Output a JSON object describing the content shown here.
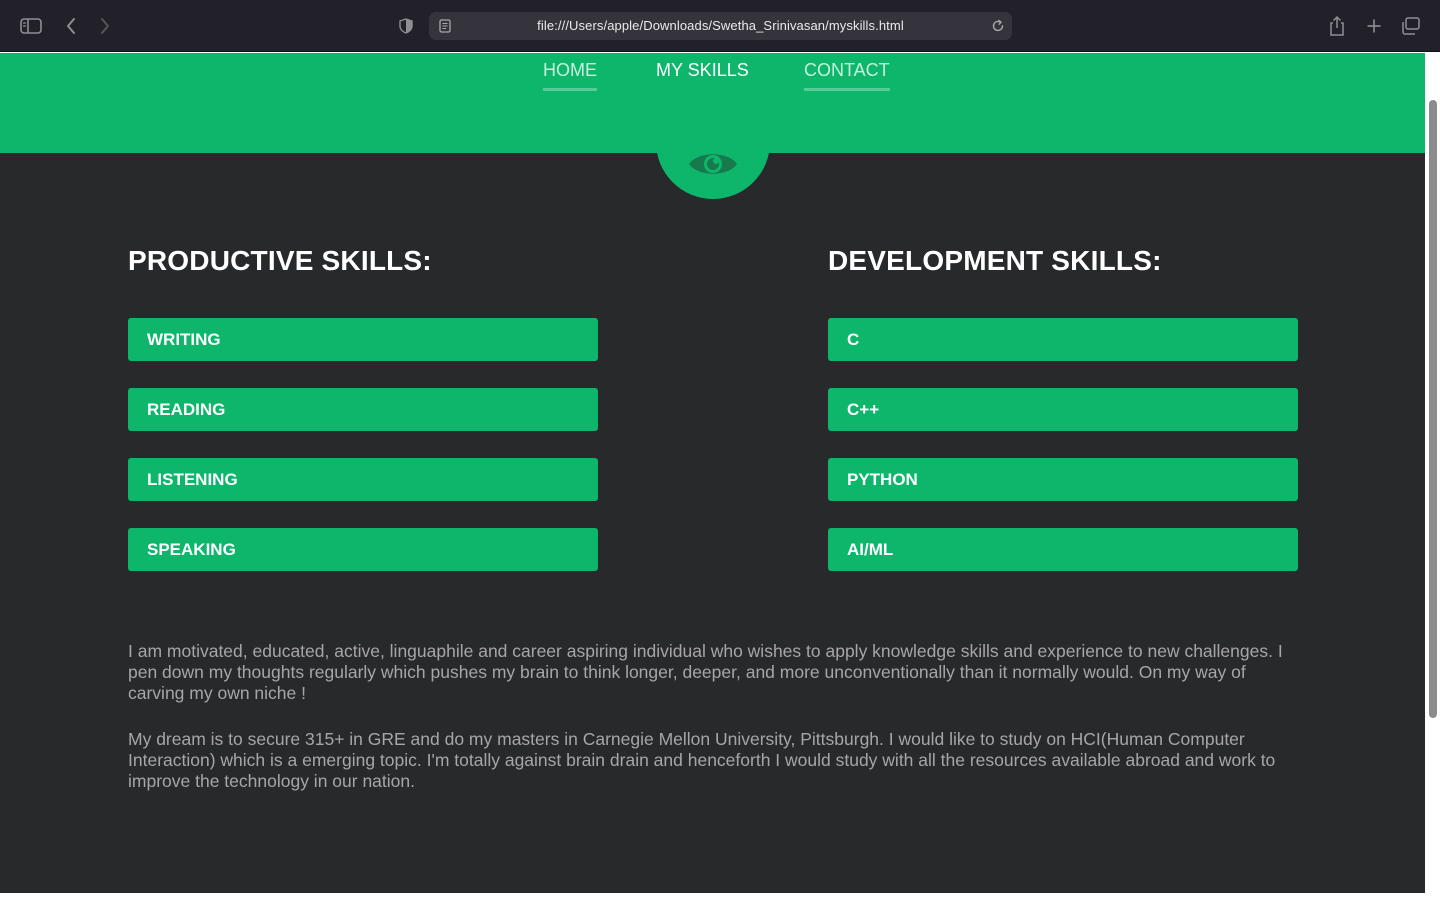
{
  "browser": {
    "url": "file:///Users/apple/Downloads/Swetha_Srinivasan/myskills.html",
    "icons": {
      "sidebar": "sidebar-icon",
      "back": "chevron-left-icon",
      "forward": "chevron-right-icon",
      "privacy": "shield-icon",
      "page": "page-icon",
      "reload": "reload-icon",
      "share": "share-icon",
      "new_tab": "plus-icon",
      "tabs": "tab-overview-icon"
    }
  },
  "nav": {
    "items": [
      {
        "label": "HOME"
      },
      {
        "label": "MY SKILLS",
        "active": true
      },
      {
        "label": "CONTACT"
      }
    ]
  },
  "badge_icon": "eye-icon",
  "colors": {
    "accent": "#0db66b",
    "background": "#28292b",
    "text_muted": "#a6a6a8"
  },
  "productive": {
    "title": "PRODUCTIVE SKILLS:",
    "skills": [
      "WRITING",
      "READING",
      "LISTENING",
      "SPEAKING"
    ]
  },
  "development": {
    "title": "DEVELOPMENT SKILLS:",
    "skills": [
      "C",
      "C++",
      "PYTHON",
      "AI/ML"
    ]
  },
  "about": {
    "paragraph1": "I am motivated, educated, active, linguaphile and career aspiring individual who wishes to apply knowledge skills and experience to new challenges. I pen down my thoughts regularly which pushes my brain to think longer, deeper, and more unconventionally than it normally would. On my way of carving my own niche !",
    "paragraph2": "My dream is to secure 315+ in GRE and do my masters in Carnegie Mellon University, Pittsburgh. I would like to study on HCI(Human Computer Interaction) which is a emerging topic. I'm totally against brain drain and henceforth I would study with all the resources available abroad and work to improve the technology in our nation."
  }
}
